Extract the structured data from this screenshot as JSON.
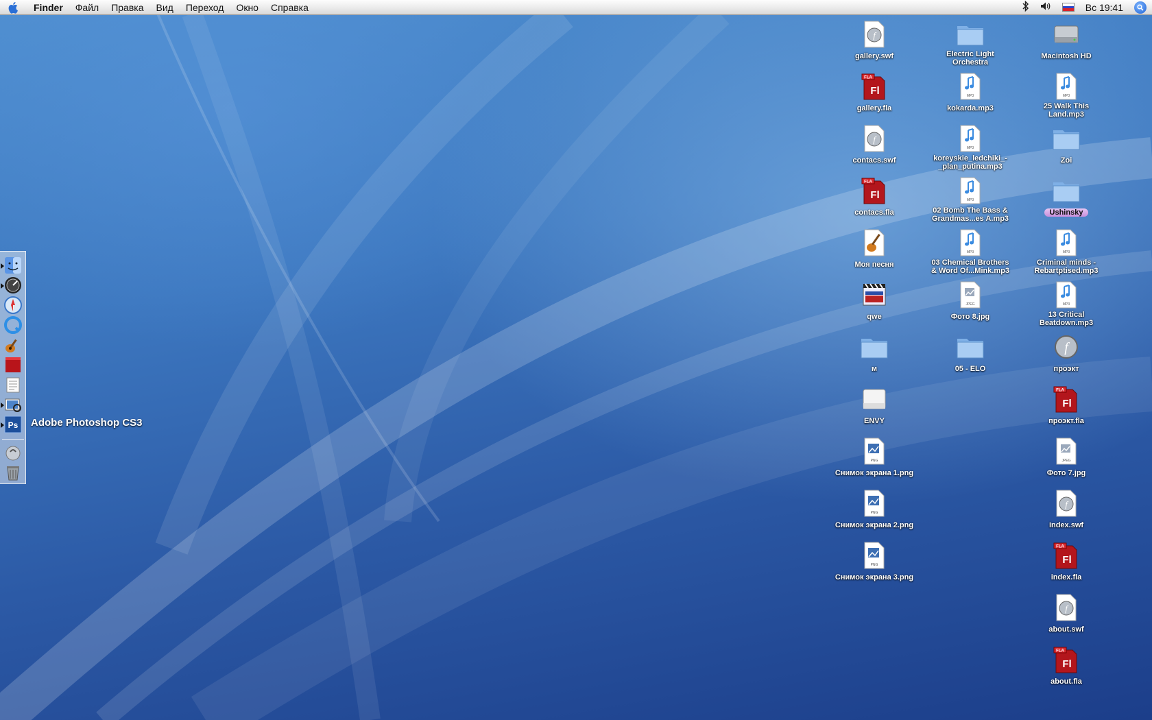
{
  "menubar": {
    "app_name": "Finder",
    "menus": [
      "Файл",
      "Правка",
      "Вид",
      "Переход",
      "Окно",
      "Справка"
    ],
    "clock": "Вс 19:41"
  },
  "dock": {
    "tooltip": "Adobe Photoshop CS3",
    "items": [
      {
        "name": "finder",
        "icon": "finder-icon",
        "running": true
      },
      {
        "name": "dashboard",
        "icon": "dashboard-icon",
        "running": true
      },
      {
        "name": "safari",
        "icon": "safari-icon",
        "running": false
      },
      {
        "name": "quicktime",
        "icon": "quicktime-icon",
        "running": false
      },
      {
        "name": "garageband",
        "icon": "garageband-icon",
        "running": false
      },
      {
        "name": "flash",
        "icon": "flash-icon",
        "running": false
      },
      {
        "name": "textedit",
        "icon": "textedit-icon",
        "running": false
      },
      {
        "name": "preview",
        "icon": "preview-icon",
        "running": true
      },
      {
        "name": "photoshop",
        "icon": "photoshop-icon",
        "running": true,
        "letters": "Ps"
      },
      {
        "name": "downloads",
        "icon": "downloads-icon",
        "running": false
      },
      {
        "name": "trash",
        "icon": "trash-icon",
        "running": false
      }
    ]
  },
  "desktop_icons": [
    {
      "label": "gallery.swf",
      "icon": "swf-file-icon",
      "col": 0,
      "row": 0
    },
    {
      "label": "gallery.fla",
      "icon": "fla-file-icon",
      "col": 0,
      "row": 1
    },
    {
      "label": "contacs.swf",
      "icon": "swf-file-icon",
      "col": 0,
      "row": 2
    },
    {
      "label": "contacs.fla",
      "icon": "fla-file-icon",
      "col": 0,
      "row": 3
    },
    {
      "label": "Моя песня",
      "icon": "garageband-file-icon",
      "col": 0,
      "row": 4
    },
    {
      "label": "qwe",
      "icon": "movie-file-icon",
      "col": 0,
      "row": 5
    },
    {
      "label": "м",
      "icon": "folder-icon",
      "col": 0,
      "row": 6
    },
    {
      "label": "ENVY",
      "icon": "external-drive-icon",
      "col": 0,
      "row": 7
    },
    {
      "label": "Снимок экрана 1.png",
      "icon": "png-file-icon",
      "col": 0,
      "row": 8
    },
    {
      "label": "Снимок экрана 2.png",
      "icon": "png-file-icon",
      "col": 0,
      "row": 9
    },
    {
      "label": "Снимок экрана 3.png",
      "icon": "png-file-icon",
      "col": 0,
      "row": 10
    },
    {
      "label": "Electric Light\nOrchestra",
      "icon": "folder-icon",
      "col": 1,
      "row": 0
    },
    {
      "label": "kokarda.mp3",
      "icon": "mp3-file-icon",
      "col": 1,
      "row": 1
    },
    {
      "label": "koreyskie_ledchiki_-\n_plan_putina.mp3",
      "icon": "mp3-file-icon",
      "col": 1,
      "row": 2
    },
    {
      "label": "02 Bomb The Bass &\nGrandmas...es A.mp3",
      "icon": "mp3-file-icon",
      "col": 1,
      "row": 3
    },
    {
      "label": "03 Chemical Brothers\n& Word Of...Mink.mp3",
      "icon": "mp3-file-icon",
      "col": 1,
      "row": 4
    },
    {
      "label": "Фото 8.jpg",
      "icon": "jpeg-file-icon",
      "col": 1,
      "row": 5
    },
    {
      "label": "05 - ELO",
      "icon": "folder-icon",
      "col": 1,
      "row": 6
    },
    {
      "label": "Macintosh HD",
      "icon": "hard-drive-icon",
      "col": 2,
      "row": 0
    },
    {
      "label": "25 Walk This\nLand.mp3",
      "icon": "mp3-file-icon",
      "col": 2,
      "row": 1
    },
    {
      "label": "Zoi",
      "icon": "folder-icon",
      "col": 2,
      "row": 2
    },
    {
      "label": "Ushinsky",
      "icon": "folder-icon",
      "col": 2,
      "row": 3,
      "tagged": true
    },
    {
      "label": "Criminal minds -\nRebartptised.mp3",
      "icon": "mp3-file-icon",
      "col": 2,
      "row": 4
    },
    {
      "label": "13 Critical\nBeatdown.mp3",
      "icon": "mp3-file-icon",
      "col": 2,
      "row": 5
    },
    {
      "label": "проэкт",
      "icon": "flash-app-icon",
      "col": 2,
      "row": 6
    },
    {
      "label": "проэкт.fla",
      "icon": "fla-file-icon",
      "col": 2,
      "row": 7
    },
    {
      "label": "Фото 7.jpg",
      "icon": "jpeg-file-icon",
      "col": 2,
      "row": 8
    },
    {
      "label": "index.swf",
      "icon": "swf-file-icon",
      "col": 2,
      "row": 9
    },
    {
      "label": "index.fla",
      "icon": "fla-file-icon",
      "col": 2,
      "row": 10
    },
    {
      "label": "about.swf",
      "icon": "swf-file-icon",
      "col": 2,
      "row": 11
    },
    {
      "label": "about.fla",
      "icon": "fla-file-icon",
      "col": 2,
      "row": 12
    }
  ]
}
